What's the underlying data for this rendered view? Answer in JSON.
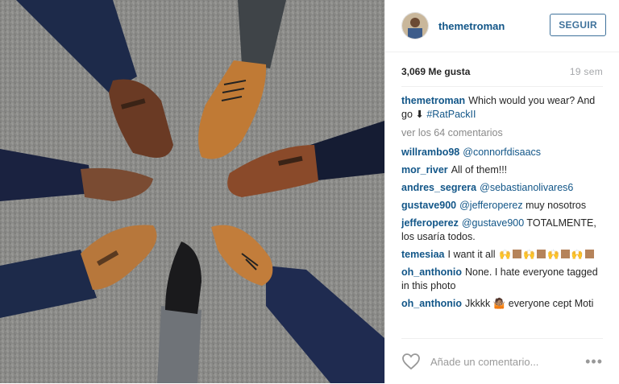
{
  "post": {
    "username": "themetroman",
    "follow_label": "SEGUIR",
    "likes": "3,069 Me gusta",
    "time": "19 sem"
  },
  "caption": {
    "username": "themetroman",
    "text": "Which would you wear? And go ⬇ ",
    "hashtag": "#RatPackII"
  },
  "view_more": "ver los 64 comentarios",
  "comments": [
    {
      "user": "willrambo98",
      "mention": "@connorfdisaacs",
      "text": ""
    },
    {
      "user": "mor_river",
      "mention": "",
      "text": "All of them!!!"
    },
    {
      "user": "andres_segrera",
      "mention": "@sebastianolivares6",
      "text": ""
    },
    {
      "user": "gustave900",
      "mention": "@jefferoperez",
      "text": " muy nosotros"
    },
    {
      "user": "jefferoperez",
      "mention": "@gustave900",
      "text": " TOTALMENTE, los usaría todos."
    },
    {
      "user": "temesiaa",
      "mention": "",
      "text": "I want it all "
    },
    {
      "user": "oh_anthonio",
      "mention": "",
      "text": "None. I hate everyone tagged in this photo"
    },
    {
      "user": "oh_anthonio",
      "mention": "",
      "text": "Jkkkk 🤷🏽 everyone cept Moti"
    }
  ],
  "footer": {
    "placeholder": "Añade un comentario...",
    "more_icon": "ellipsis-icon"
  },
  "colors": {
    "link": "#125688",
    "follow": "#3f729b",
    "muted": "#a5a7aa"
  }
}
